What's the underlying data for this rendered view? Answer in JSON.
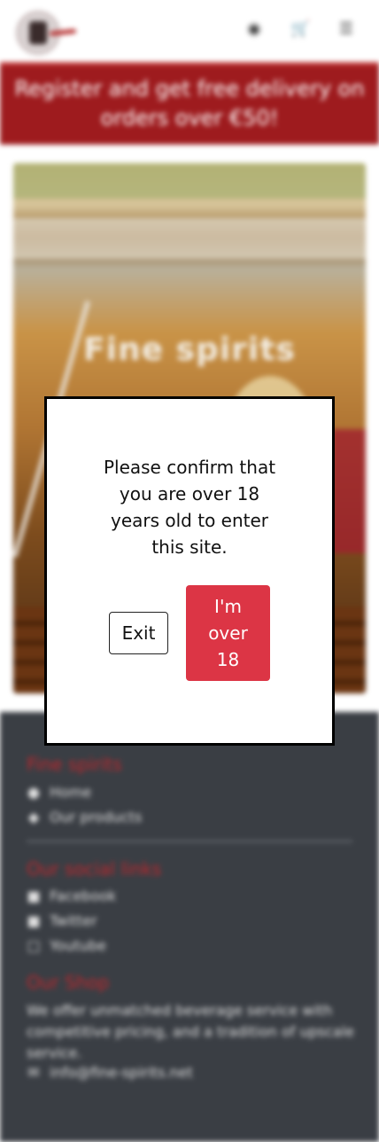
{
  "header": {
    "logo_icon": "spirits-logo-icon",
    "icons": [
      "user-icon",
      "cart-icon",
      "menu-icon"
    ]
  },
  "banner": {
    "text": "Register and get free delivery on orders over €50!"
  },
  "hero": {
    "title": "Fine spirits"
  },
  "footer": {
    "section1": {
      "heading": "Fine spirits",
      "items": [
        {
          "icon": "map-pin-icon",
          "label": "Home"
        },
        {
          "icon": "tag-icon",
          "label": "Our products"
        }
      ]
    },
    "section2": {
      "heading": "Our social links",
      "items": [
        {
          "icon": "facebook-icon",
          "label": "Facebook"
        },
        {
          "icon": "twitter-icon",
          "label": "Twitter"
        },
        {
          "icon": "youtube-icon",
          "label": "Youtube"
        }
      ]
    },
    "section3": {
      "heading": "Our Shop",
      "description": "We offer unmatched beverage service with competitive pricing, and a tradition of upscale service.",
      "email": "info@fine-spirits.net",
      "email_icon": "envelope-icon"
    }
  },
  "modal": {
    "message": "Please confirm that you are over 18 years old to enter this site.",
    "exit_label": "Exit",
    "confirm_label": "I'm over 18"
  },
  "colors": {
    "banner": "#9e1b1e",
    "footer": "#3a3e44",
    "accent_heading": "#c0262c",
    "confirm_button": "#dc3545"
  }
}
